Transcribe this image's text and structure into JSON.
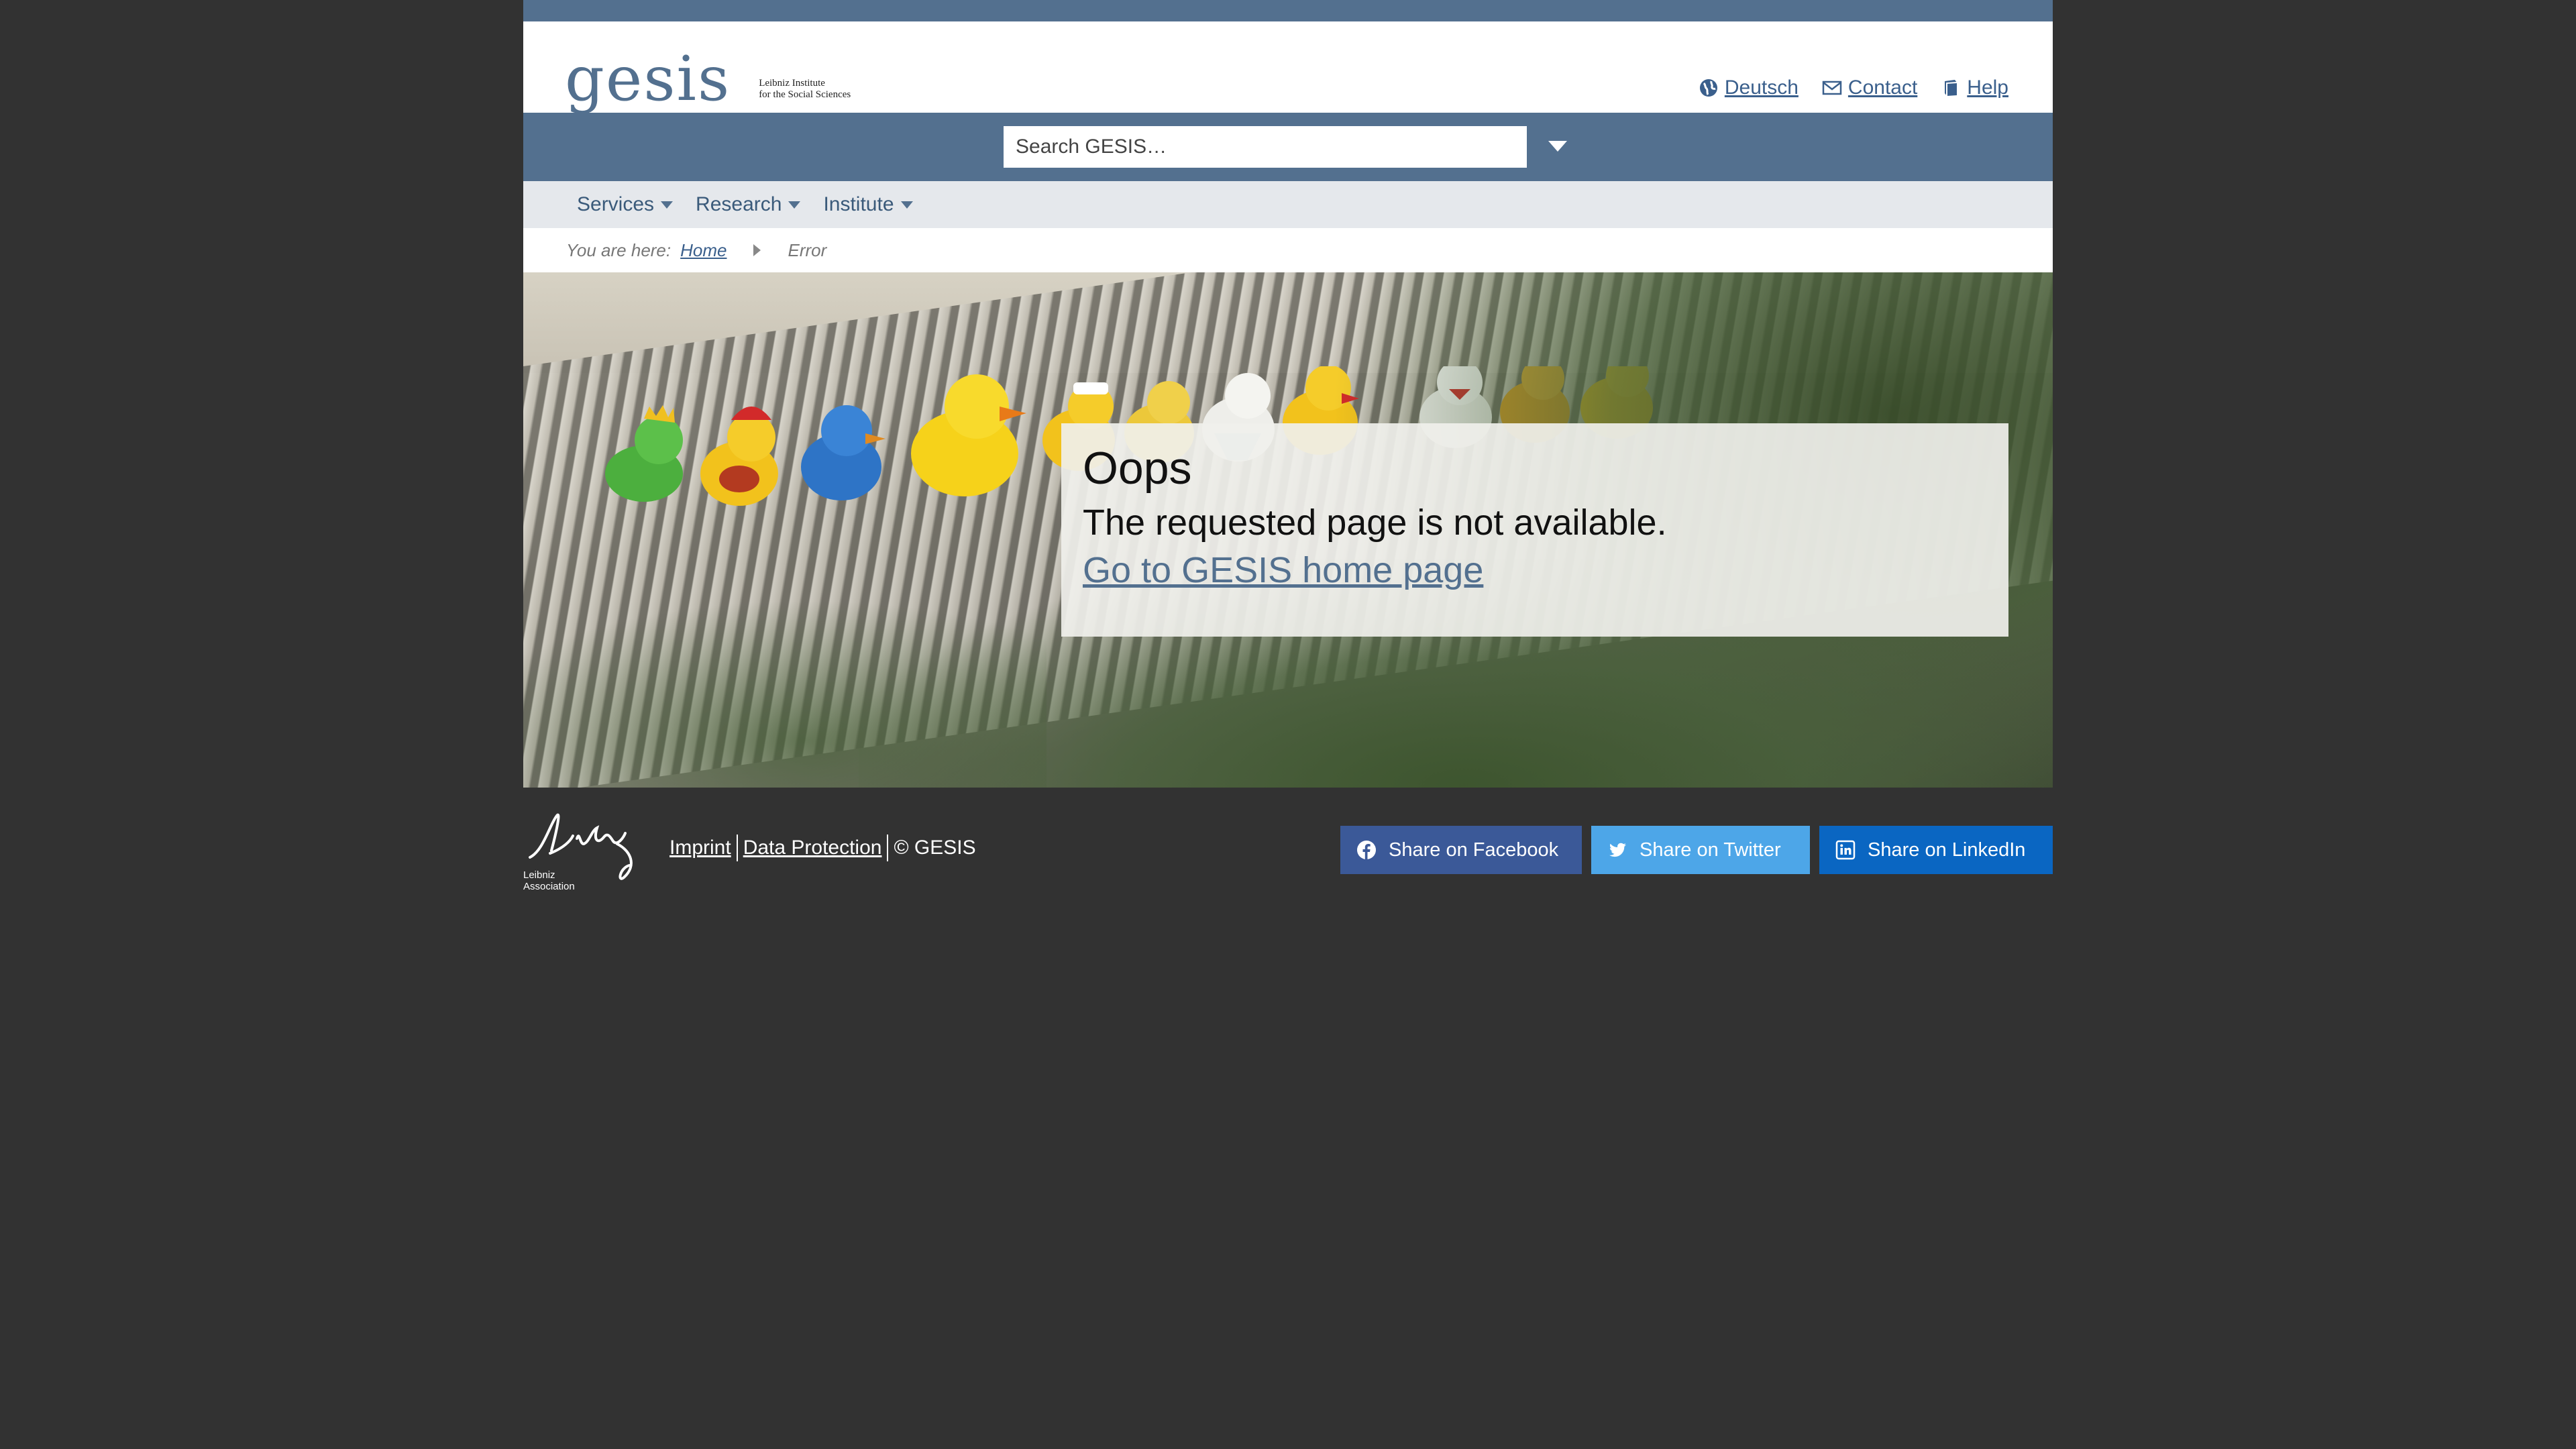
{
  "header": {
    "logo_word": "gesis",
    "logo_sub_line1": "Leibniz Institute",
    "logo_sub_line2": "for the Social Sciences",
    "links": [
      {
        "label": "Deutsch",
        "icon": "globe-icon"
      },
      {
        "label": "Contact",
        "icon": "envelope-icon"
      },
      {
        "label": "Help",
        "icon": "book-icon"
      }
    ]
  },
  "search": {
    "placeholder": "Search GESIS…",
    "toggle_icon": "caret-down-icon"
  },
  "nav": {
    "items": [
      {
        "label": "Services"
      },
      {
        "label": "Research"
      },
      {
        "label": "Institute"
      }
    ]
  },
  "breadcrumb": {
    "prefix": "You are here:",
    "home": "Home",
    "current": "Error"
  },
  "error": {
    "title": "Oops",
    "message": "The requested page is not available.",
    "home_link": "Go to GESIS home page"
  },
  "footer": {
    "leibniz_line1": "Leibniz",
    "leibniz_line2": "Association",
    "imprint": "Imprint",
    "data_protection": "Data Protection",
    "copyright": "© GESIS",
    "share": {
      "facebook": "Share on Facebook",
      "twitter": "Share on Twitter",
      "linkedin": "Share on LinkedIn"
    }
  },
  "colors": {
    "brand": "#53708f",
    "background": "#323232",
    "facebook": "#3b5998",
    "twitter": "#4da6e8",
    "linkedin": "#0a66c2"
  }
}
